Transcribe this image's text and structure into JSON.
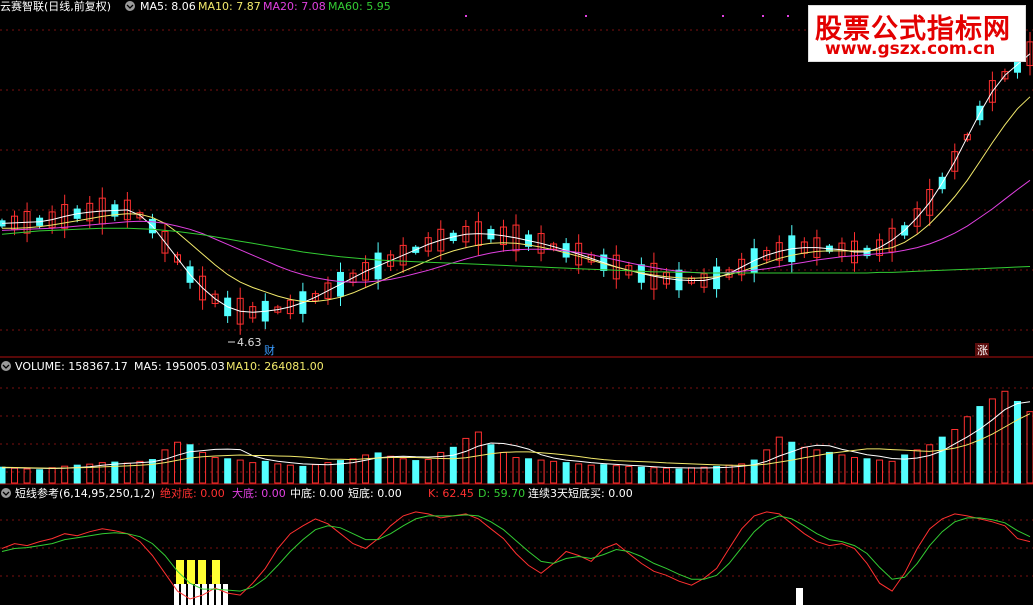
{
  "header": {
    "stock": "云赛智联(日线,前复权)",
    "ma_items": [
      {
        "text": "MA5: 8.06",
        "color": "#ffffff"
      },
      {
        "text": "MA10: 7.87",
        "color": "#f2e96b"
      },
      {
        "text": "MA20: 7.08",
        "color": "#e040e0"
      },
      {
        "text": "MA60: 5.95",
        "color": "#33cc33"
      }
    ]
  },
  "price_annotations": {
    "low_label": "4.63",
    "cai_label": "财",
    "zhang_label": "涨"
  },
  "volume_header": [
    {
      "text": "VOLUME: 158367.17",
      "color": "#ffffff"
    },
    {
      "text": "MA5: 195005.03",
      "color": "#ffffff"
    },
    {
      "text": "MA10: 264081.00",
      "color": "#f2e96b"
    }
  ],
  "indicator_header": [
    {
      "text": "短线参考(6,14,95,250,1,2)",
      "color": "#ffffff"
    },
    {
      "text": "绝对底: 0.00",
      "color": "#ff3030"
    },
    {
      "text": "大底: 0.00",
      "color": "#e040e0"
    },
    {
      "text": "中底: 0.00",
      "color": "#ffffff"
    },
    {
      "text": "短底: 0.00",
      "color": "#ffffff"
    },
    {
      "text": "K: 62.45",
      "color": "#ff3030"
    },
    {
      "text": "D: 59.70",
      "color": "#33cc33"
    },
    {
      "text": "连续3天短底买: 0.00",
      "color": "#ffffff"
    }
  ],
  "watermark": {
    "line1": "股票公式指标网",
    "line2": "www.gszx.com.cn"
  },
  "colors": {
    "up": "#ff3030",
    "down": "#54ffff",
    "ma5": "#ffffff",
    "ma10": "#f2e96b",
    "ma20": "#e040e0",
    "ma60": "#33cc33",
    "k": "#ff3030",
    "d": "#33cc33",
    "grid": "#7a1010"
  },
  "chart_data": [
    {
      "type": "candlestick",
      "title": "云赛智联(日线,前复权)",
      "series": [
        {
          "name": "MA5",
          "values": [
            6.75,
            6.76,
            6.77,
            6.78,
            6.82,
            6.88,
            6.93,
            6.96,
            6.98,
            6.99,
            7.0,
            6.9,
            6.7,
            6.4,
            6.1,
            5.8,
            5.55,
            5.35,
            5.2,
            5.12,
            5.1,
            5.12,
            5.15,
            5.2,
            5.28,
            5.38,
            5.5,
            5.62,
            5.74,
            5.86,
            5.96,
            6.06,
            6.16,
            6.26,
            6.36,
            6.44,
            6.5,
            6.55,
            6.56,
            6.55,
            6.52,
            6.48,
            6.43,
            6.38,
            6.32,
            6.25,
            6.18,
            6.1,
            6.02,
            5.94,
            5.88,
            5.82,
            5.77,
            5.73,
            5.7,
            5.69,
            5.69,
            5.74,
            5.82,
            5.94,
            6.06,
            6.16,
            6.23,
            6.28,
            6.3,
            6.3,
            6.28,
            6.26,
            6.22,
            6.22,
            6.3,
            6.44,
            6.62,
            6.86,
            7.14,
            7.5,
            7.9,
            8.35,
            8.8,
            9.2,
            9.5,
            9.7,
            9.9
          ]
        },
        {
          "name": "MA10",
          "values": [
            6.66,
            6.66,
            6.67,
            6.69,
            6.72,
            6.76,
            6.8,
            6.84,
            6.88,
            6.91,
            6.93,
            6.92,
            6.86,
            6.75,
            6.58,
            6.38,
            6.18,
            5.98,
            5.8,
            5.66,
            5.56,
            5.48,
            5.4,
            5.34,
            5.3,
            5.3,
            5.33,
            5.38,
            5.46,
            5.56,
            5.66,
            5.76,
            5.86,
            5.96,
            6.06,
            6.16,
            6.24,
            6.3,
            6.35,
            6.38,
            6.39,
            6.38,
            6.35,
            6.31,
            6.26,
            6.2,
            6.14,
            6.07,
            6.0,
            5.94,
            5.88,
            5.83,
            5.79,
            5.76,
            5.74,
            5.73,
            5.74,
            5.76,
            5.8,
            5.86,
            5.94,
            6.02,
            6.1,
            6.16,
            6.2,
            6.23,
            6.24,
            6.24,
            6.24,
            6.24,
            6.26,
            6.3,
            6.4,
            6.55,
            6.74,
            6.98,
            7.25,
            7.55,
            7.9,
            8.25,
            8.58,
            8.88,
            9.1
          ]
        },
        {
          "name": "MA20",
          "values": [
            6.62,
            6.63,
            6.64,
            6.65,
            6.66,
            6.68,
            6.7,
            6.72,
            6.74,
            6.76,
            6.78,
            6.79,
            6.78,
            6.75,
            6.7,
            6.64,
            6.56,
            6.46,
            6.36,
            6.26,
            6.16,
            6.06,
            5.96,
            5.87,
            5.8,
            5.74,
            5.7,
            5.67,
            5.66,
            5.66,
            5.68,
            5.71,
            5.76,
            5.82,
            5.88,
            5.95,
            6.02,
            6.09,
            6.15,
            6.2,
            6.24,
            6.26,
            6.27,
            6.27,
            6.26,
            6.24,
            6.21,
            6.17,
            6.12,
            6.07,
            6.02,
            5.97,
            5.93,
            5.89,
            5.86,
            5.84,
            5.83,
            5.83,
            5.84,
            5.86,
            5.88,
            5.91,
            5.95,
            5.99,
            6.03,
            6.07,
            6.1,
            6.13,
            6.15,
            6.17,
            6.19,
            6.21,
            6.25,
            6.3,
            6.37,
            6.46,
            6.57,
            6.7,
            6.86,
            7.02,
            7.2,
            7.38,
            7.55
          ]
        },
        {
          "name": "MA60",
          "values": [
            6.55,
            6.57,
            6.59,
            6.61,
            6.62,
            6.63,
            6.64,
            6.65,
            6.66,
            6.66,
            6.66,
            6.65,
            6.64,
            6.62,
            6.6,
            6.57,
            6.54,
            6.5,
            6.46,
            6.42,
            6.38,
            6.34,
            6.3,
            6.26,
            6.22,
            6.19,
            6.16,
            6.13,
            6.11,
            6.09,
            6.07,
            6.06,
            6.05,
            6.04,
            6.03,
            6.02,
            6.01,
            6.0,
            5.99,
            5.98,
            5.97,
            5.96,
            5.95,
            5.94,
            5.93,
            5.92,
            5.91,
            5.9,
            5.89,
            5.88,
            5.87,
            5.86,
            5.85,
            5.85,
            5.84,
            5.84,
            5.83,
            5.83,
            5.83,
            5.83,
            5.83,
            5.83,
            5.83,
            5.83,
            5.83,
            5.83,
            5.83,
            5.83,
            5.83,
            5.83,
            5.84,
            5.84,
            5.85,
            5.86,
            5.87,
            5.88,
            5.89,
            5.9,
            5.91,
            5.92,
            5.93,
            5.94,
            5.95
          ]
        }
      ],
      "low_marker": 4.63
    },
    {
      "type": "bar",
      "title": "VOLUME",
      "values": [
        62,
        58,
        55,
        52,
        60,
        66,
        70,
        74,
        80,
        82,
        78,
        85,
        92,
        130,
        160,
        150,
        120,
        100,
        95,
        90,
        80,
        85,
        75,
        70,
        65,
        72,
        80,
        88,
        95,
        110,
        118,
        105,
        95,
        88,
        92,
        120,
        140,
        175,
        200,
        150,
        120,
        100,
        95,
        90,
        85,
        80,
        75,
        70,
        72,
        68,
        65,
        62,
        60,
        58,
        55,
        60,
        62,
        65,
        70,
        75,
        90,
        130,
        180,
        160,
        140,
        130,
        120,
        110,
        100,
        95,
        90,
        85,
        110,
        130,
        150,
        180,
        210,
        260,
        300,
        330,
        360,
        320,
        280
      ],
      "series": [
        {
          "name": "MA5",
          "values": [
            60,
            60,
            59,
            58,
            57,
            58,
            61,
            64,
            70,
            74,
            77,
            80,
            83,
            93,
            109,
            123,
            127,
            132,
            133,
            131,
            107,
            94,
            85,
            80,
            75,
            73,
            72,
            75,
            80,
            89,
            99,
            103,
            105,
            103,
            102,
            104,
            109,
            124,
            145,
            157,
            155,
            146,
            133,
            111,
            98,
            90,
            85,
            80,
            76,
            73,
            70,
            67,
            64,
            61,
            60,
            59,
            59,
            60,
            62,
            66,
            72,
            85,
            106,
            123,
            140,
            148,
            146,
            132,
            122,
            111,
            105,
            96,
            94,
            98,
            108,
            126,
            154,
            181,
            212,
            248,
            288,
            312,
            319
          ]
        },
        {
          "name": "MA10",
          "values": [
            62,
            61,
            60,
            59,
            58,
            59,
            60,
            61,
            63,
            65,
            67,
            70,
            73,
            80,
            89,
            98,
            103,
            106,
            108,
            110,
            108,
            108,
            106,
            105,
            102,
            98,
            94,
            93,
            92,
            95,
            98,
            100,
            100,
            100,
            98,
            96,
            95,
            99,
            107,
            115,
            120,
            122,
            122,
            119,
            115,
            110,
            104,
            97,
            92,
            88,
            86,
            84,
            82,
            79,
            77,
            75,
            73,
            71,
            70,
            69,
            70,
            74,
            82,
            90,
            99,
            108,
            116,
            122,
            128,
            134,
            134,
            131,
            129,
            126,
            124,
            129,
            137,
            150,
            169,
            192,
            220,
            248,
            272
          ]
        }
      ],
      "ylim": [
        0,
        420
      ]
    },
    {
      "type": "line",
      "title": "短线参考(6,14,95,250,1,2)",
      "series": [
        {
          "name": "K",
          "values": [
            55,
            60,
            58,
            62,
            65,
            70,
            68,
            72,
            75,
            73,
            70,
            62,
            48,
            30,
            12,
            4,
            8,
            15,
            10,
            8,
            20,
            35,
            55,
            70,
            78,
            85,
            80,
            70,
            60,
            55,
            65,
            78,
            88,
            92,
            90,
            86,
            88,
            90,
            85,
            75,
            65,
            50,
            38,
            30,
            40,
            52,
            48,
            42,
            55,
            60,
            50,
            40,
            32,
            28,
            22,
            18,
            25,
            35,
            55,
            75,
            88,
            92,
            90,
            80,
            70,
            62,
            58,
            60,
            55,
            40,
            20,
            12,
            30,
            55,
            75,
            85,
            90,
            88,
            85,
            82,
            78,
            65,
            62
          ]
        },
        {
          "name": "D",
          "values": [
            52,
            55,
            56,
            58,
            60,
            64,
            66,
            68,
            70,
            71,
            70,
            67,
            60,
            48,
            32,
            20,
            14,
            14,
            13,
            12,
            16,
            25,
            38,
            52,
            64,
            74,
            78,
            76,
            70,
            64,
            64,
            70,
            78,
            85,
            88,
            88,
            88,
            89,
            88,
            82,
            74,
            63,
            52,
            42,
            40,
            45,
            47,
            45,
            49,
            54,
            52,
            47,
            40,
            35,
            29,
            24,
            24,
            28,
            40,
            56,
            72,
            83,
            88,
            85,
            78,
            70,
            64,
            62,
            58,
            50,
            36,
            24,
            26,
            40,
            58,
            72,
            82,
            86,
            86,
            84,
            81,
            73,
            67
          ]
        }
      ],
      "ylim": [
        0,
        100
      ]
    }
  ]
}
